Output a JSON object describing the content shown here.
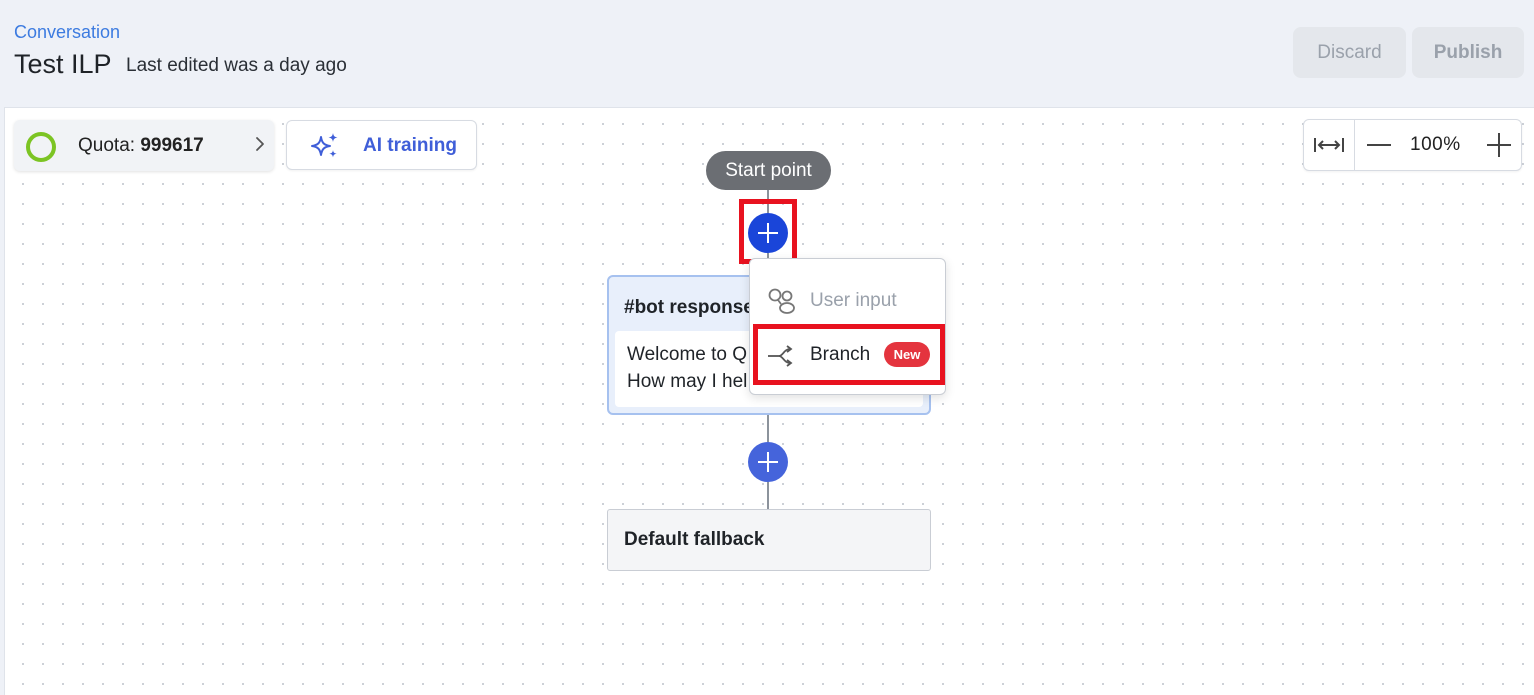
{
  "header": {
    "breadcrumb": "Conversation",
    "title": "Test ILP",
    "last_edited": "Last edited was a day ago",
    "discard_label": "Discard",
    "publish_label": "Publish"
  },
  "toolbar": {
    "quota_label": "Quota:",
    "quota_value": "999617",
    "ai_training_label": "AI training",
    "zoom_level": "100%"
  },
  "flow": {
    "start_label": "Start point",
    "bot_node": {
      "title": "#bot response",
      "message_line1": "Welcome to Q",
      "message_line2": "How may I hel"
    },
    "fallback_title": "Default fallback"
  },
  "add_menu": {
    "items": [
      {
        "label": "User input",
        "disabled": true
      },
      {
        "label": "Branch",
        "badge": "New"
      }
    ]
  },
  "colors": {
    "accent": "#1a45d9",
    "highlight": "#e8121f",
    "quota_ring": "#7cc423",
    "new_badge": "#e4343e"
  }
}
